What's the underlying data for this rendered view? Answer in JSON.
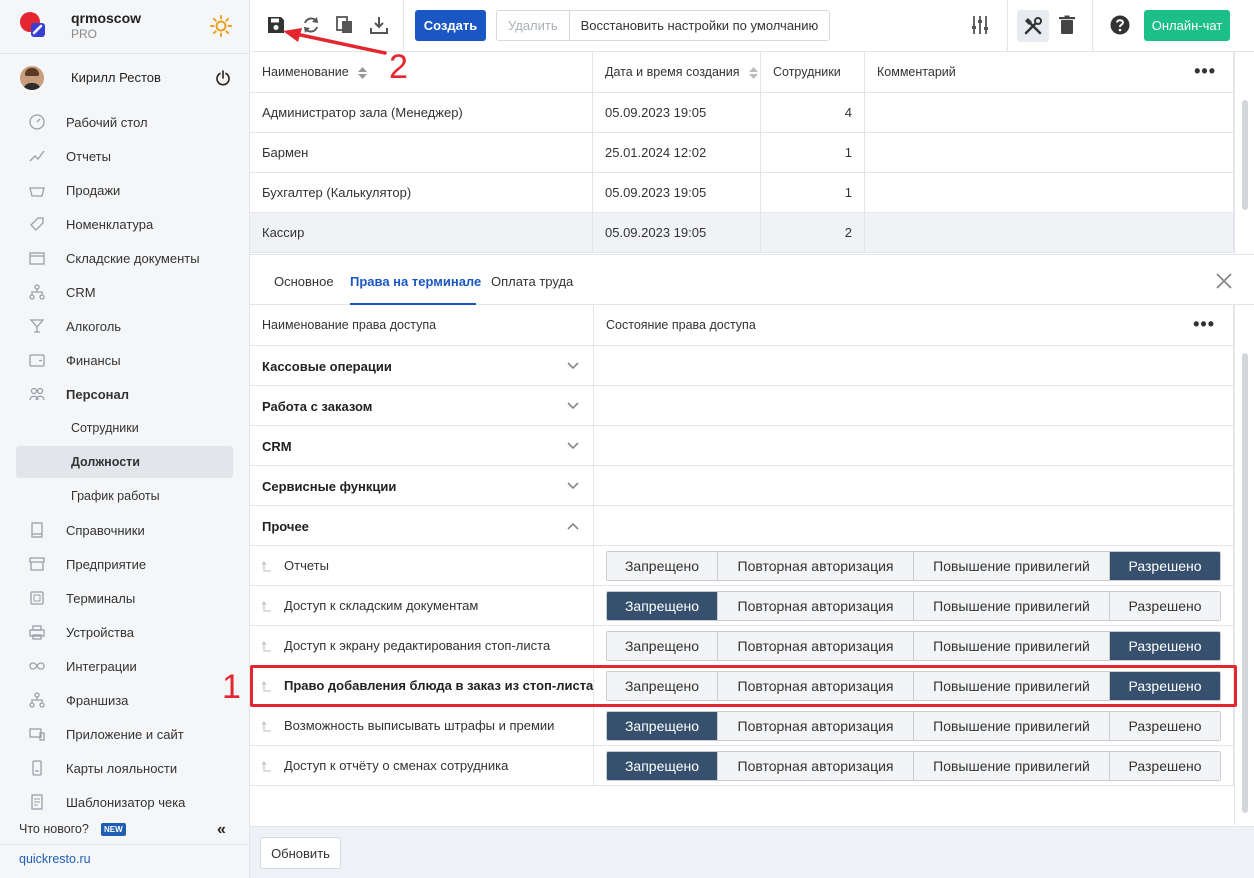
{
  "brand": {
    "name": "qrmoscow",
    "plan": "PRO"
  },
  "user": {
    "name": "Кирилл Рестов"
  },
  "sidebar": {
    "items": [
      {
        "label": "Рабочий стол",
        "icon": "dashboard-icon"
      },
      {
        "label": "Отчеты",
        "icon": "reports-icon"
      },
      {
        "label": "Продажи",
        "icon": "basket-icon"
      },
      {
        "label": "Номенклатура",
        "icon": "tag-icon"
      },
      {
        "label": "Складские документы",
        "icon": "box-icon"
      },
      {
        "label": "CRM",
        "icon": "org-icon"
      },
      {
        "label": "Алкоголь",
        "icon": "cocktail-icon"
      },
      {
        "label": "Финансы",
        "icon": "wallet-icon"
      },
      {
        "label": "Персонал",
        "icon": "people-icon"
      },
      {
        "label": "Сотрудники"
      },
      {
        "label": "Должности"
      },
      {
        "label": "График работы"
      },
      {
        "label": "Справочники",
        "icon": "book-icon"
      },
      {
        "label": "Предприятие",
        "icon": "store-icon"
      },
      {
        "label": "Терминалы",
        "icon": "terminal-icon"
      },
      {
        "label": "Устройства",
        "icon": "printer-icon"
      },
      {
        "label": "Интеграции",
        "icon": "infinity-icon"
      },
      {
        "label": "Франшиза",
        "icon": "org-icon"
      },
      {
        "label": "Приложение и сайт",
        "icon": "devices-icon"
      },
      {
        "label": "Карты лояльности",
        "icon": "card-icon"
      },
      {
        "label": "Шаблонизатор чека",
        "icon": "receipt-icon"
      }
    ],
    "whats_new": "Что нового?",
    "new_badge": "NEW",
    "site": "quickresto.ru"
  },
  "toolbar": {
    "create": "Создать",
    "delete": "Удалить",
    "restore": "Восстановить настройки по умолчанию",
    "chat": "Онлайн-чат"
  },
  "positions": {
    "headers": [
      "Наименование",
      "Дата и время создания",
      "Сотрудники",
      "Комментарий"
    ],
    "rows": [
      {
        "name": "Администратор зала (Менеджер)",
        "date": "05.09.2023 19:05",
        "count": "4",
        "comment": ""
      },
      {
        "name": "Бармен",
        "date": "25.01.2024 12:02",
        "count": "1",
        "comment": ""
      },
      {
        "name": "Бухгалтер (Калькулятор)",
        "date": "05.09.2023 19:05",
        "count": "1",
        "comment": ""
      },
      {
        "name": "Кассир",
        "date": "05.09.2023 19:05",
        "count": "2",
        "comment": ""
      }
    ]
  },
  "tabs": [
    "Основное",
    "Права на терминале",
    "Оплата труда"
  ],
  "permissions": {
    "headers": [
      "Наименование права доступа",
      "Состояние права доступа"
    ],
    "groups": [
      "Кассовые операции",
      "Работа с заказом",
      "CRM",
      "Сервисные функции",
      "Прочее"
    ],
    "states": [
      "Запрещено",
      "Повторная авторизация",
      "Повышение привилегий",
      "Разрешено"
    ],
    "items": [
      {
        "label": "Отчеты",
        "state": "Разрешено"
      },
      {
        "label": "Доступ к складским документам",
        "state": "Запрещено"
      },
      {
        "label": "Доступ к экрану редактирования стоп-листа",
        "state": "Разрешено"
      },
      {
        "label": "Право добавления блюда в заказ из стоп-листа",
        "state": "Разрешено"
      },
      {
        "label": "Возможность выписывать штрафы и премии",
        "state": "Запрещено"
      },
      {
        "label": "Доступ к отчёту о сменах сотрудника",
        "state": "Запрещено"
      }
    ]
  },
  "bottom": {
    "refresh": "Обновить"
  },
  "annotations": {
    "one": "1",
    "two": "2"
  },
  "colors": {
    "accent": "#1a56c4",
    "chat": "#1cbf87",
    "selected_state": "#36506e",
    "annotation": "#e3262f"
  }
}
